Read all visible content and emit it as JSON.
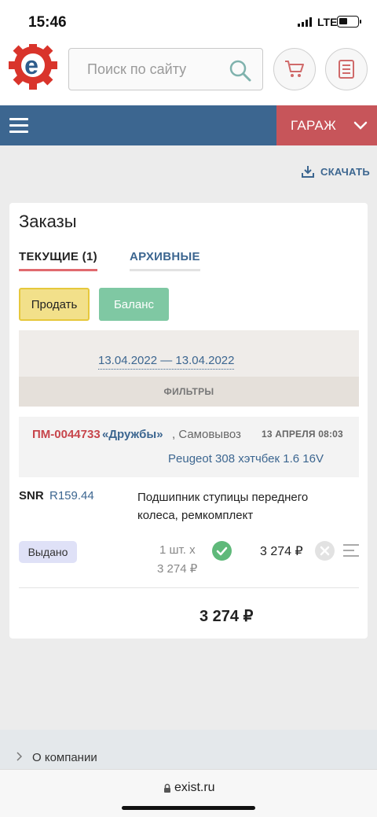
{
  "status_bar": {
    "time": "15:46",
    "network": "LTE"
  },
  "header": {
    "logo_icon": "exist-gear-logo",
    "search": {
      "placeholder": "Поиск по сайту",
      "value": ""
    },
    "cart_icon": "cart-icon",
    "orders_icon": "list-icon"
  },
  "nav": {
    "menu_icon": "hamburger-icon",
    "garage_label": "ГАРАЖ"
  },
  "download_label": "СКАЧАТЬ",
  "orders": {
    "title": "Заказы",
    "tabs": [
      {
        "label": "ТЕКУЩИЕ (1)",
        "active": true
      },
      {
        "label": "АРХИВНЫЕ",
        "active": false
      }
    ],
    "buttons": {
      "sell": "Продать",
      "balance": "Баланс"
    },
    "date_range": "13.04.2022 — 13.04.2022",
    "filters_label": "ФИЛЬТРЫ",
    "order": {
      "number": "ПМ-0044733",
      "name": "«Дружбы»",
      "delivery": ", Самовывоз",
      "date": "13 АПРЕЛЯ 08:03",
      "car": "Peugeot 308 хэтчбек 1.6 16V",
      "item": {
        "brand": "SNR",
        "code": "R159.44",
        "description": "Подшипник ступицы переднего колеса, ремкомплект",
        "status": "Выдано",
        "quantity": "1 шт. x",
        "unit_price": "3 274 ₽",
        "total": "3 274 ₽"
      },
      "grand_total": "3 274 ₽"
    }
  },
  "footer": {
    "about": "О компании"
  },
  "browser": {
    "url": "exist.ru"
  },
  "colors": {
    "primary": "#3c6690",
    "accent": "#c7555a",
    "sell": "#f2e08a",
    "balance": "#7fc8a3"
  }
}
